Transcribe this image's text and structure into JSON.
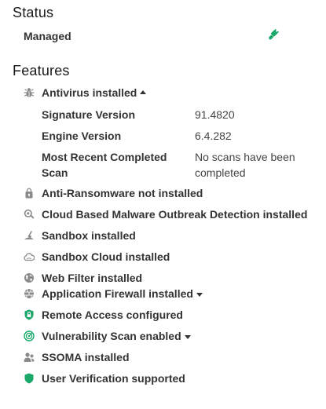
{
  "status": {
    "title": "Status",
    "managed_label": "Managed",
    "managed_icon": "connected-plug-icon"
  },
  "features": {
    "title": "Features",
    "antivirus": {
      "label": "Antivirus installed",
      "expanded": true,
      "details": [
        {
          "key": "Signature Version",
          "value": "91.4820"
        },
        {
          "key": "Engine Version",
          "value": "6.4.282"
        },
        {
          "key": "Most Recent Completed Scan",
          "value": "No scans have been completed"
        }
      ]
    },
    "items": [
      {
        "label": "Anti-Ransomware not installed",
        "icon": "lock-bag-icon",
        "color": "#8a8a8a"
      },
      {
        "label": "Cloud Based Malware Outbreak Detection installed",
        "icon": "magnifier-icon",
        "color": "#8a8a8a"
      },
      {
        "label": "Sandbox installed",
        "icon": "sandbox-icon",
        "color": "#8a8a8a"
      },
      {
        "label": "Sandbox Cloud installed",
        "icon": "cloud-icon",
        "color": "#8a8a8a"
      },
      {
        "label": "Web Filter installed",
        "icon": "globe-icon",
        "color": "#8a8a8a"
      },
      {
        "label": "Application Firewall installed",
        "icon": "firewall-globe-icon",
        "color": "#8a8a8a",
        "dropdown": true
      },
      {
        "label": "Remote Access configured",
        "icon": "shield-lock-icon",
        "color": "#1aa86a"
      },
      {
        "label": "Vulnerability Scan enabled",
        "icon": "radar-icon",
        "color": "#1aa86a",
        "dropdown": true
      },
      {
        "label": "SSOMA installed",
        "icon": "users-icon",
        "color": "#8a8a8a"
      },
      {
        "label": "User Verification supported",
        "icon": "shield-icon",
        "color": "#1aa86a"
      }
    ]
  },
  "colors": {
    "accent_green": "#1aa86a",
    "icon_gray": "#8a8a8a"
  }
}
